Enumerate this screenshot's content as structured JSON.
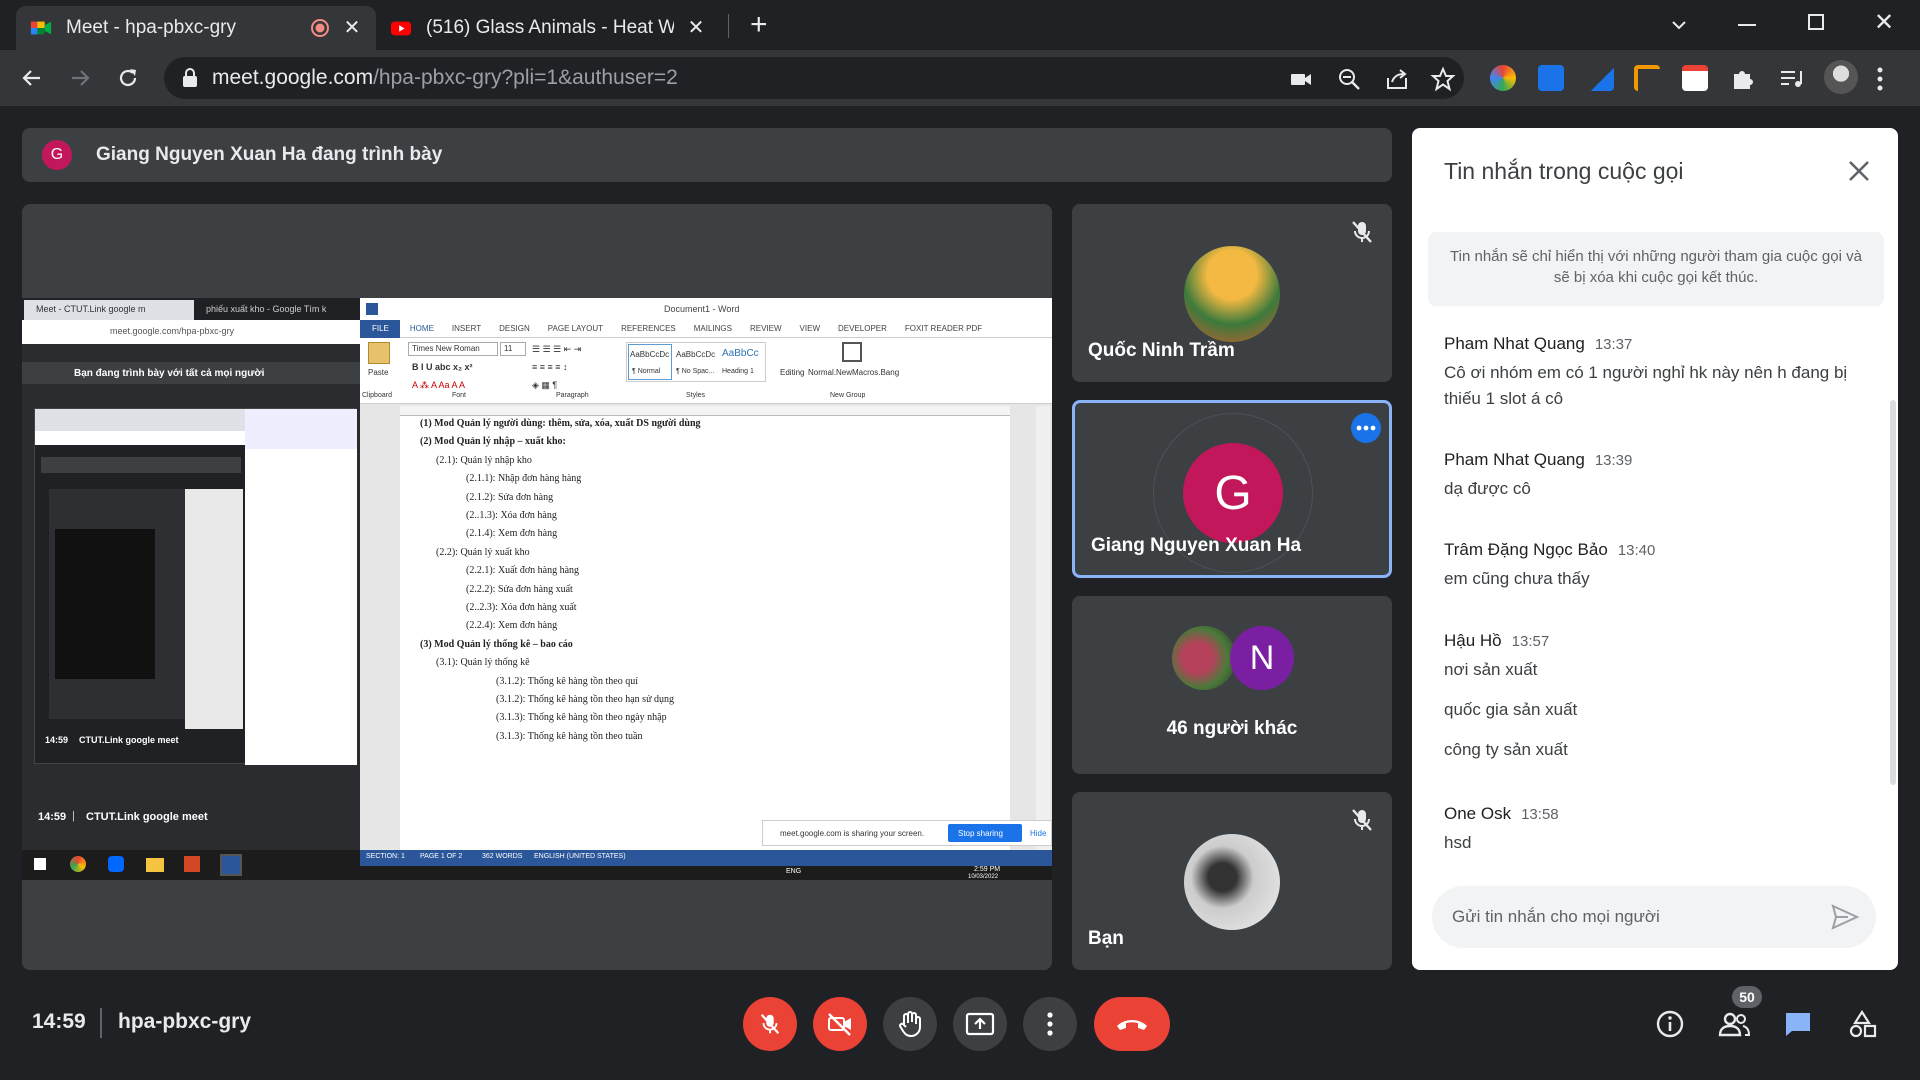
{
  "browser": {
    "tabs": [
      {
        "title": "Meet - hpa-pbxc-gry",
        "active": true
      },
      {
        "title": "(516) Glass Animals - Heat Waves",
        "active": false
      }
    ],
    "url_host": "meet.google.com",
    "url_path": "/hpa-pbxc-gry?pli=1&authuser=2"
  },
  "meet": {
    "presenter_initial": "G",
    "presenter_banner": "Giang Nguyen Xuan Ha đang trình bày",
    "participants": [
      {
        "name": "Quốc Ninh Trầm",
        "muted": true
      },
      {
        "name": "Giang Nguyen Xuan Ha",
        "initial": "G",
        "color": "#c2185b",
        "muted": false,
        "active_border": "#8ab4f8"
      },
      {
        "name": "46 người khác",
        "initial": "N",
        "color": "#7b1fa2"
      },
      {
        "name": "Bạn",
        "muted": true
      }
    ],
    "time": "14:59",
    "meeting_code": "hpa-pbxc-gry",
    "people_count": "50"
  },
  "shared_screen": {
    "meet_tab": "Meet - CTUT.Link google m",
    "second_tab": "phiếu xuất kho - Google Tìm k",
    "url": "meet.google.com/hpa-pbxc-gry",
    "presenting_banner": "Bạn đang trình bày với tất cả mọi người",
    "word_title": "Document1 - Word",
    "ribbon_tabs": [
      "FILE",
      "HOME",
      "INSERT",
      "DESIGN",
      "PAGE LAYOUT",
      "REFERENCES",
      "MAILINGS",
      "REVIEW",
      "VIEW",
      "DEVELOPER",
      "FOXIT READER PDF"
    ],
    "font_name": "Times New Roman",
    "font_size": "11",
    "styles": [
      "AaBbCcDc",
      "AaBbCcDc",
      "AaBbCc"
    ],
    "style_names": [
      "¶ Normal",
      "¶ No Spac...",
      "Heading 1"
    ],
    "editing": "Editing",
    "macro": "Normal.NewMacros.Bang",
    "groups": [
      "Clipboard",
      "Font",
      "Paragraph",
      "Styles",
      "New Group"
    ],
    "paste": "Paste",
    "doc_lines": [
      {
        "indent": 0,
        "bold": true,
        "text": "(1)  Mod Quản lý người dùng: thêm, sửa, xóa, xuất DS người dùng"
      },
      {
        "indent": 0,
        "bold": true,
        "text": "(2)  Mod Quản lý nhập – xuất kho:"
      },
      {
        "indent": 1,
        "bold": false,
        "text": "(2.1): Quản lý nhập kho"
      },
      {
        "indent": 2,
        "bold": false,
        "text": "(2.1.1): Nhập đơn hàng hàng"
      },
      {
        "indent": 2,
        "bold": false,
        "text": "(2.1.2): Sửa đơn hàng"
      },
      {
        "indent": 2,
        "bold": false,
        "text": "(2..1.3): Xóa đơn hàng"
      },
      {
        "indent": 2,
        "bold": false,
        "text": "(2.1.4): Xem đơn hàng"
      },
      {
        "indent": 1,
        "bold": false,
        "text": "(2.2): Quản lý xuất kho"
      },
      {
        "indent": 2,
        "bold": false,
        "text": "(2.2.1): Xuất đơn hàng hàng"
      },
      {
        "indent": 2,
        "bold": false,
        "text": "(2.2.2): Sửa đơn hàng xuất"
      },
      {
        "indent": 2,
        "bold": false,
        "text": "(2..2.3): Xóa đơn hàng xuất"
      },
      {
        "indent": 2,
        "bold": false,
        "text": "(2.2.4): Xem đơn hàng"
      },
      {
        "indent": 0,
        "bold": true,
        "text": "(3)  Mod Quản lý thống kê – bao cáo"
      },
      {
        "indent": 1,
        "bold": false,
        "text": "(3.1): Quản lý thống kê"
      },
      {
        "indent": 3,
        "bold": false,
        "text": "(3.1.2): Thống kê hàng tồn theo quí"
      },
      {
        "indent": 3,
        "bold": false,
        "text": "(3.1.2): Thống kê hàng tồn theo hạn sử dụng"
      },
      {
        "indent": 3,
        "bold": false,
        "text": "(3.1.3): Thống kê hàng tồn theo ngày nhập"
      },
      {
        "indent": 3,
        "bold": false,
        "text": "(3.1.3): Thống kê hàng tồn theo tuần"
      }
    ],
    "status": [
      "SECTION: 1",
      "PAGE 1 OF 2",
      "362 WORDS",
      "ENGLISH (UNITED STATES)"
    ],
    "sharing_notice": "meet.google.com is sharing your screen.",
    "stop_sharing": "Stop sharing",
    "hide": "Hide",
    "inner_time": "14:59",
    "inner_label": "CTUT.Link google meet",
    "inner_time_small": "14:59",
    "inner_label_small": "CTUT.Link google meet",
    "taskbar_lang": "ENG",
    "taskbar_time": "2:59 PM",
    "taskbar_date": "10/03/2022"
  },
  "chat": {
    "title": "Tin nhắn trong cuộc gọi",
    "notice": "Tin nhắn sẽ chỉ hiển thị với những người tham gia cuộc gọi và sẽ bị xóa khi cuộc gọi kết thúc.",
    "messages": [
      {
        "sender": "Pham Nhat Quang",
        "time": "13:37",
        "lines": [
          "Cô ơi nhóm em có 1 người nghỉ hk này nên h đang bị thiếu 1 slot á cô"
        ]
      },
      {
        "sender": "Pham Nhat Quang",
        "time": "13:39",
        "lines": [
          "dạ được cô"
        ]
      },
      {
        "sender": "Trâm Đặng Ngọc Bảo",
        "time": "13:40",
        "lines": [
          "em cũng chưa thấy"
        ]
      },
      {
        "sender": "Hậu Hồ",
        "time": "13:57",
        "lines": [
          "nơi sản xuất",
          "quốc gia sản xuất",
          "công ty sản xuất"
        ]
      },
      {
        "sender": "One Osk",
        "time": "13:58",
        "lines": [
          "hsd"
        ]
      }
    ],
    "input_placeholder": "Gửi tin nhắn cho mọi người"
  },
  "colors": {
    "accent": "#8ab4f8",
    "danger": "#ea4335",
    "bg": "#202124",
    "tile": "#3c4043"
  }
}
